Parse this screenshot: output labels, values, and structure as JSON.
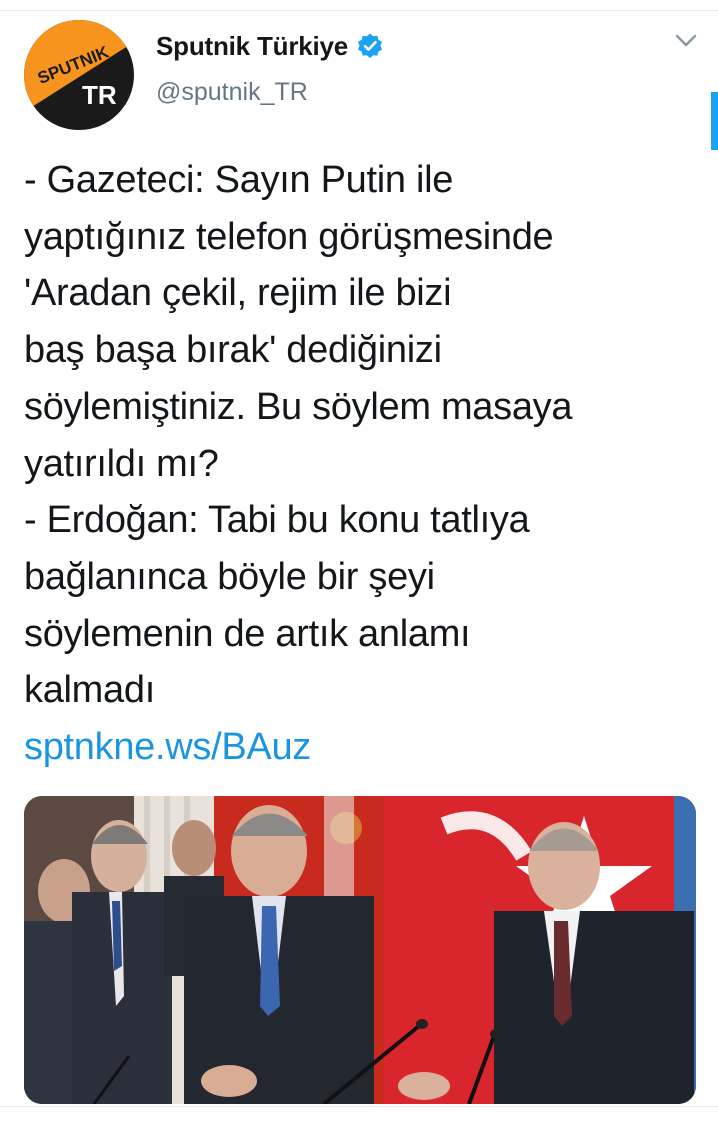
{
  "tweet": {
    "author": {
      "display_name": "Sputnik Türkiye",
      "handle": "@sputnik_TR",
      "verified": true,
      "avatar": {
        "logo_text_top": "SPUTNIK",
        "logo_text_bottom": "TR",
        "colors": {
          "orange": "#f7941d",
          "black": "#1a1a1a"
        }
      }
    },
    "menu_icon": "chevron-down-icon",
    "text_lines": [
      "- Gazeteci: Sayın Putin ile",
      "yaptığınız telefon görüşmesinde",
      "'Aradan çekil, rejim ile bizi",
      "baş başa bırak' dediğinizi",
      "söylemiştiniz. Bu söylem masaya",
      "yatırıldı mı?",
      "- Erdoğan: Tabi bu konu tatlıya",
      "bağlanınca böyle bir şeyi",
      "söylemenin de artık anlamı",
      "kalmadı"
    ],
    "link_text": "sptnkne.ws/BAuz",
    "media": {
      "type": "photo",
      "flag_colors": {
        "turkey_red": "#d8262c",
        "russia_red": "#c82a1e"
      }
    }
  },
  "colors": {
    "link": "#1b95e0",
    "secondary_text": "#657786",
    "verified_badge": "#1da1f2",
    "divider": "#e6ecf0"
  }
}
